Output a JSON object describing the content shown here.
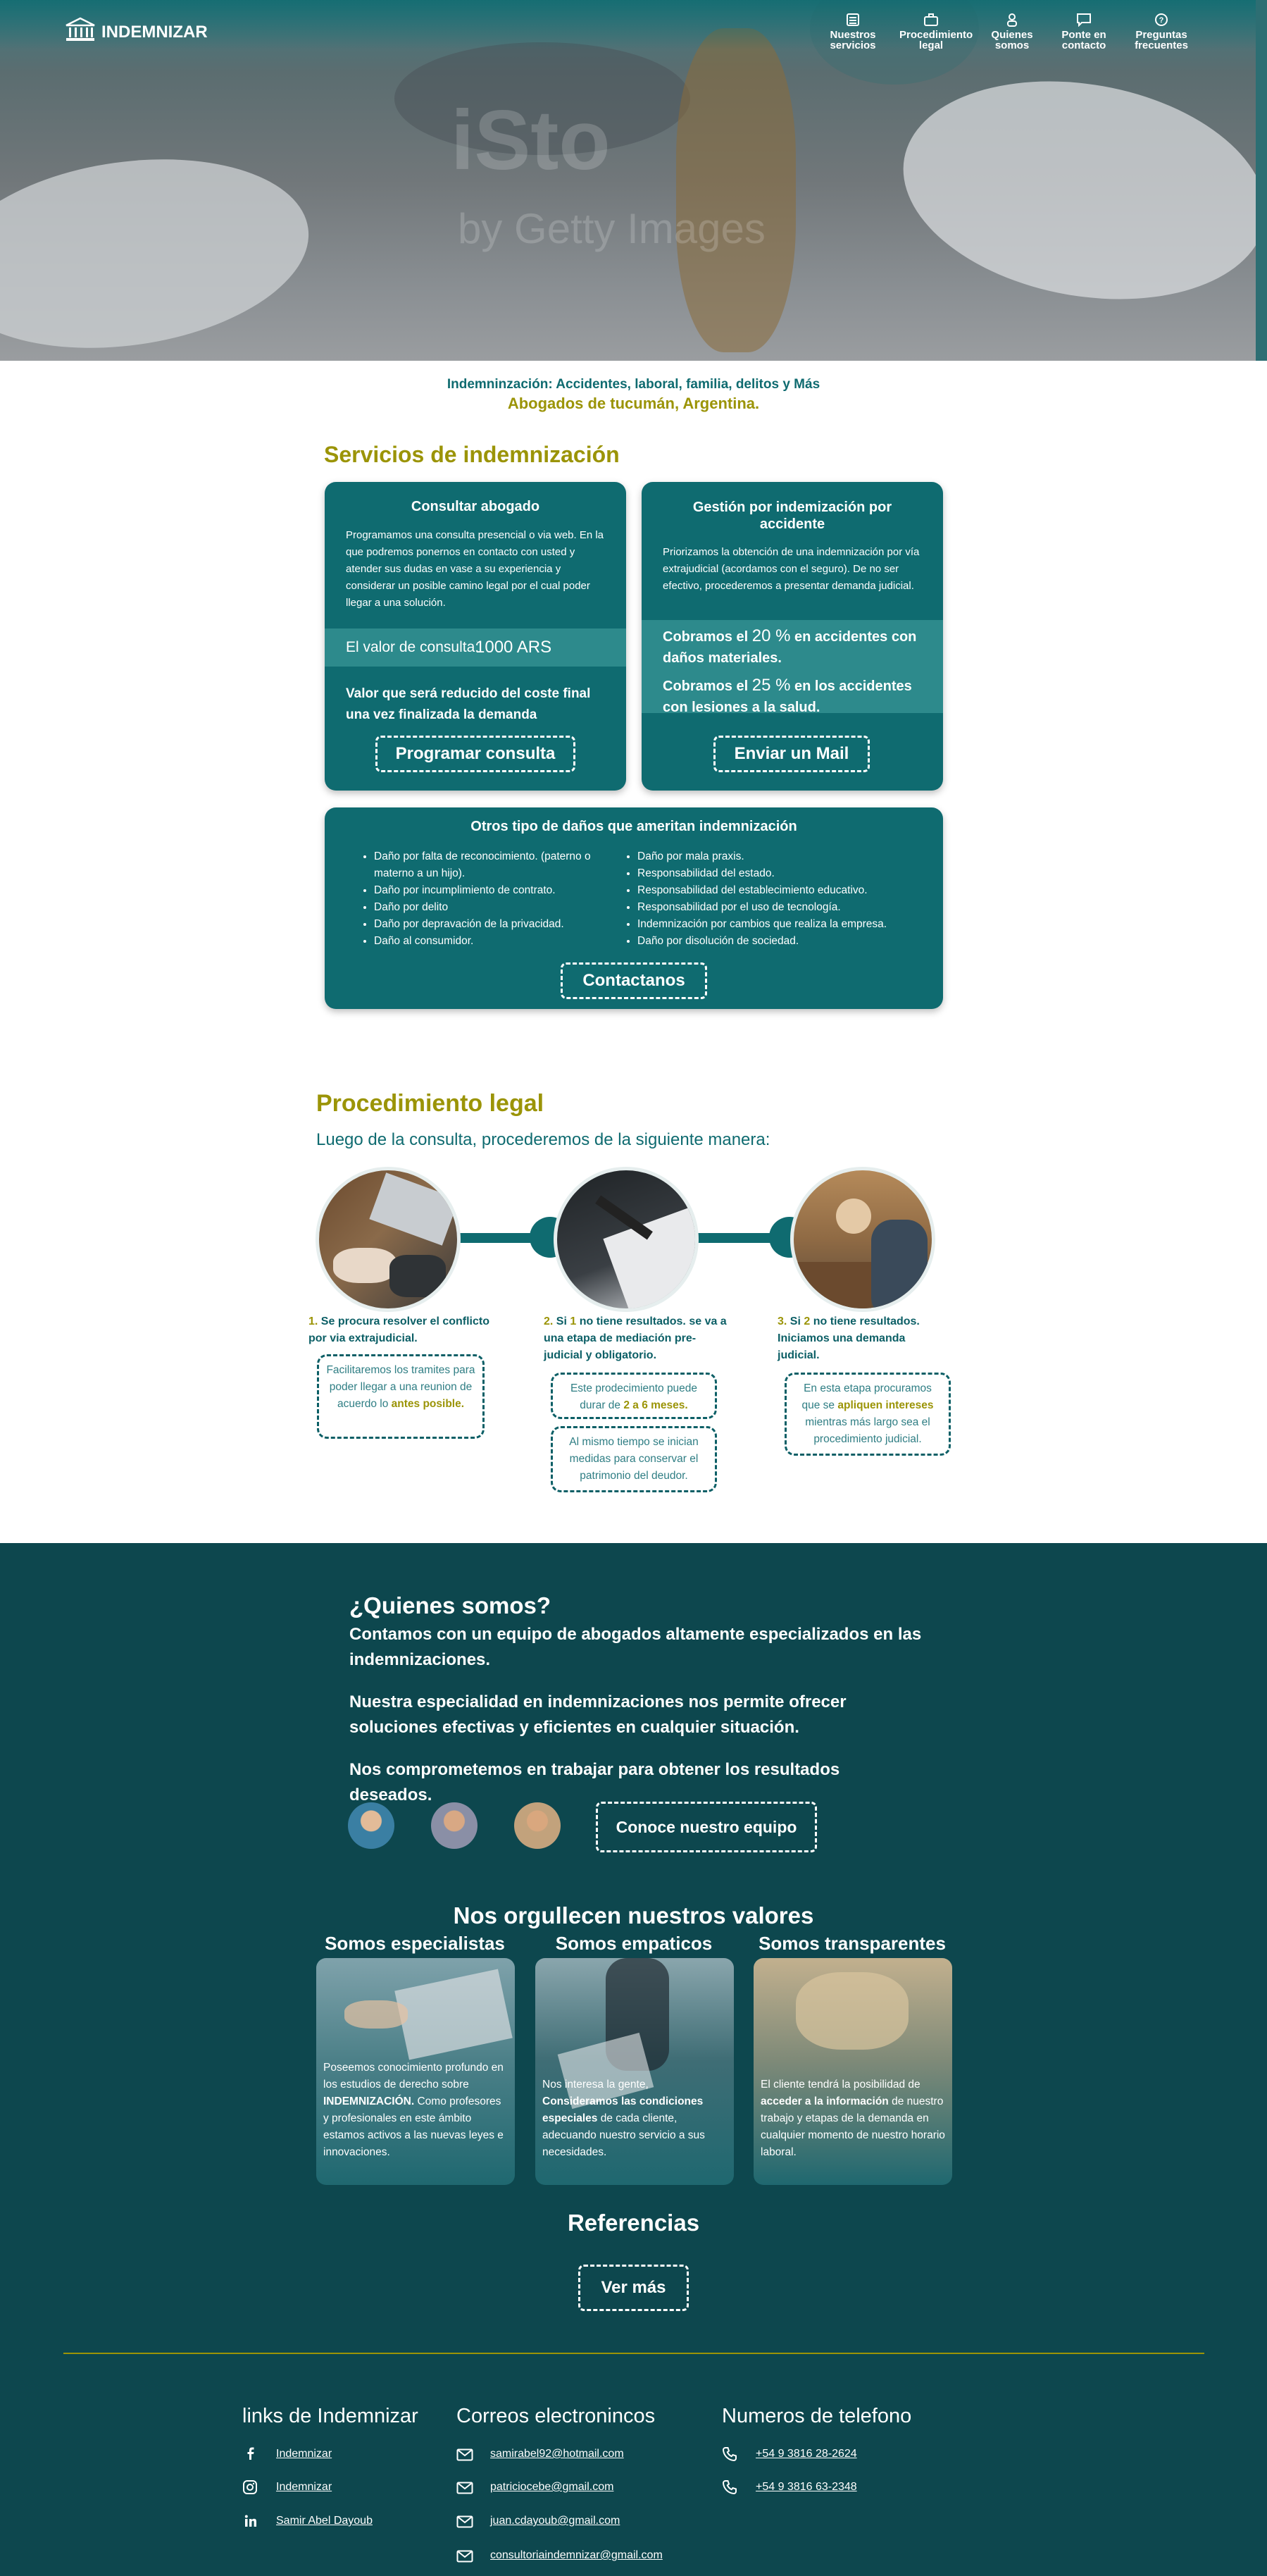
{
  "brand": {
    "name": "INDEMNIZAR"
  },
  "nav": [
    {
      "label": "Nuestros servicios",
      "icon": "list-icon"
    },
    {
      "label": "Procedimiento legal",
      "icon": "briefcase-icon"
    },
    {
      "label": "Quienes somos",
      "icon": "people-icon"
    },
    {
      "label": "Ponte en contacto",
      "icon": "chat-icon"
    },
    {
      "label": "Preguntas frecuentes",
      "icon": "question-icon"
    }
  ],
  "hero": {
    "watermark_line1": "iSto",
    "watermark_line2": "by Getty Images"
  },
  "intro": {
    "line1": "Indemninzación: Accidentes, laboral, familia, delitos y Más",
    "line2": "Abogados de tucumán, Argentina."
  },
  "services": {
    "title": "Servicios de indemnización",
    "consult": {
      "title": "Consultar abogado",
      "text": "Programamos una consulta presencial o via web. En la que podremos ponernos en contacto con usted y atender sus dudas en vase a su experiencia y considerar un posible camino legal por el cual poder llegar a una solución.",
      "price_label": "El valor de consulta:",
      "price_value": "1000 ARS",
      "reduced": "Valor que será reducido del coste final una vez finalizada la demanda",
      "button": "Programar consulta"
    },
    "accident": {
      "title": "Gestión por indemización por accidente",
      "text": "Priorizamos la obtención de una indemnización por vía extrajudicial (acordamos con el seguro). De no ser efectivo, procederemos a presentar demanda judicial.",
      "line1_pre": "Cobramos el",
      "line1_pct": "20 %",
      "line1_post": "en accidentes con daños materiales.",
      "line2_pre": "Cobramos el",
      "line2_pct": "25 %",
      "line2_post": "en los accidentes con lesiones a la salud.",
      "button": "Enviar un Mail"
    },
    "other": {
      "title": "Otros tipo de daños que ameritan indemnización",
      "left": [
        "Daño por falta de reconocimiento. (paterno o materno a un hijo).",
        "Daño por incumplimiento de contrato.",
        "Daño por delito",
        "Daño por depravación de la privacidad.",
        "Daño al consumidor."
      ],
      "right": [
        "Daño por mala praxis.",
        "Responsabilidad del estado.",
        "Responsabilidad del establecimiento educativo.",
        "Responsabilidad por el uso de tecnología.",
        "Indemnización por cambios que realiza la empresa.",
        "Daño por disolución de sociedad."
      ],
      "button": "Contactanos"
    }
  },
  "procedure": {
    "title": "Procedimiento legal",
    "subtitle": "Luego de la consulta, procederemos de la siguiente manera:",
    "steps": [
      {
        "num": "1.",
        "text": "Se procura resolver el conflicto por via extrajudicial.",
        "note_pre": "Facilitaremos los tramites para poder llegar a una reunion de acuerdo lo",
        "note_hl": "antes posible."
      },
      {
        "num": "2.",
        "text_pre": "Si",
        "text_num": "1",
        "text_post": "no tiene resultados. se va a una etapa de mediación pre-judicial y obligatorio.",
        "note_pre": "Este prodecimiento puede durar de",
        "note_hl": "2 a 6 meses.",
        "note2": "Al mismo tiempo se inician medidas para conservar el patrimonio del deudor."
      },
      {
        "num": "3.",
        "text_pre": "Si",
        "text_num": "2",
        "text_post": "no tiene resultados. Iniciamos una demanda judicial.",
        "note_pre": "En esta etapa procuramos que se",
        "note_hl": "apliquen intereses",
        "note_post": "mientras más largo sea el procedimiento judicial."
      }
    ]
  },
  "about": {
    "title": "¿Quienes somos?",
    "p1": "Contamos con un equipo de abogados altamente especializados en las indemnizaciones.",
    "p2": "Nuestra especialidad en indemnizaciones nos permite ofrecer soluciones efectivas y eficientes en cualquier situación.",
    "p3": "Nos comprometemos en trabajar para obtener los resultados deseados.",
    "button": "Conoce nuestro equipo"
  },
  "values": {
    "title": "Nos orgullecen nuestros valores",
    "items": [
      {
        "title": "Somos especialistas",
        "t1": "Poseemos conocimiento profundo en los estudios de derecho sobre",
        "hl": "INDEMNIZACIÓN.",
        "t2": "Como profesores y profesionales en este ámbito estamos activos a las nuevas leyes e innovaciones."
      },
      {
        "title": "Somos empaticos",
        "t1": "Nos interesa la gente,",
        "hl": "Consideramos las condiciones especiales",
        "t2": "de cada cliente, adecuando nuestro servicio a sus necesidades."
      },
      {
        "title": "Somos transparentes",
        "t1": "El cliente tendrá la posibilidad de",
        "hl": "acceder a la información",
        "t2": "de nuestro trabajo y etapas de la demanda en cualquier momento de nuestro horario laboral."
      }
    ]
  },
  "references": {
    "title": "Referencias",
    "button": "Ver más"
  },
  "footer": {
    "links_title": "links de Indemnizar",
    "links": [
      "Indemnizar",
      "Indemnizar",
      "Samir Abel Dayoub"
    ],
    "emails_title": "Correos electronincos",
    "emails": [
      "samirabel92@hotmail.com",
      "patriciocebe@gmail.com",
      "juan.cdayoub@gmail.com",
      "consultoriaindemnizar@gmail.com"
    ],
    "phones_title": "Numeros de telefono",
    "phones": [
      "+54 9 3816 28-2624",
      "+54 9 3816 63-2348"
    ]
  },
  "colors": {
    "teal": "#0f6b70",
    "olive": "#9b9407",
    "dark": "#0d474e"
  }
}
